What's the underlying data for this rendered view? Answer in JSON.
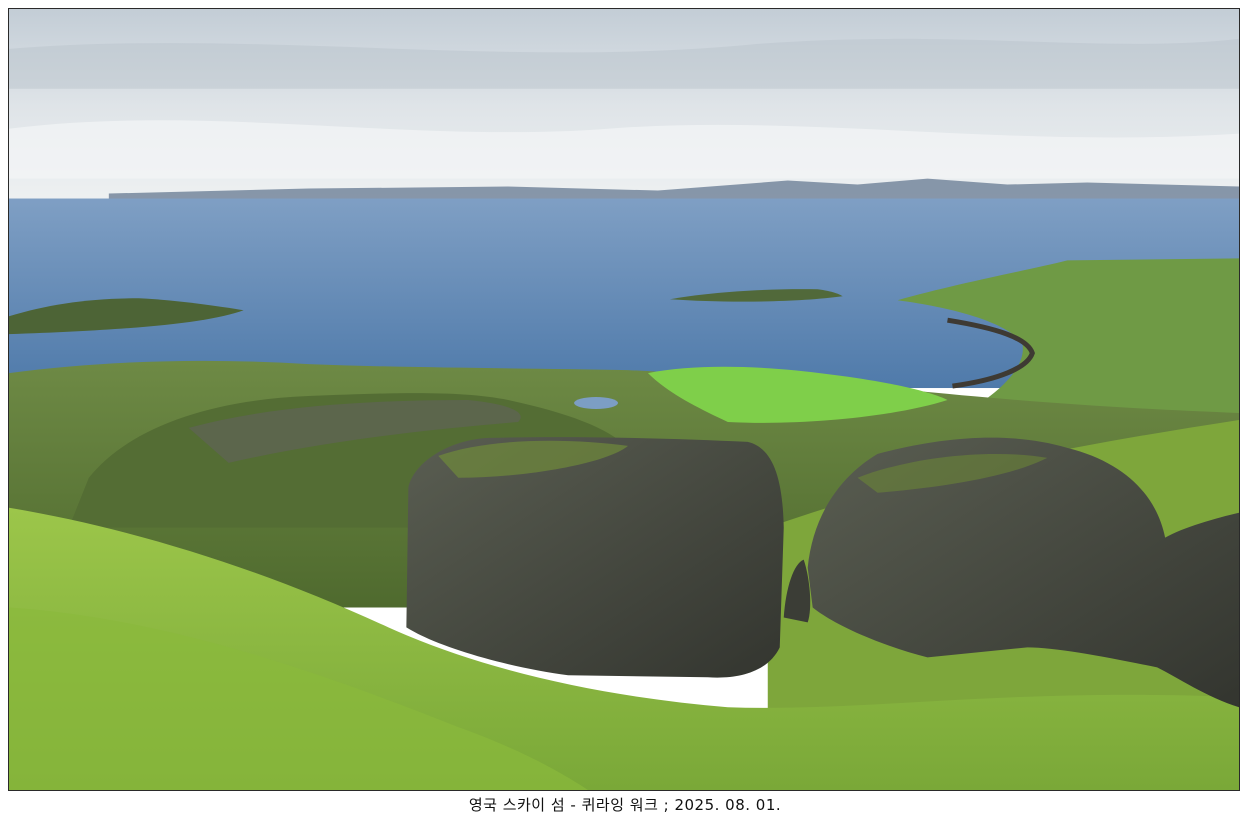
{
  "photo": {
    "caption": "영국 스카이 섬 - 퀴라잉 워크 ; 2025. 08. 01.",
    "colors": {
      "frame_border": "#2a2a2a",
      "sky_top": "#c9d2da",
      "sky_bottom": "#e8ecef",
      "sea": "#5f86b3",
      "grass": "#8fbf3f",
      "rock": "#4a4d47"
    }
  }
}
